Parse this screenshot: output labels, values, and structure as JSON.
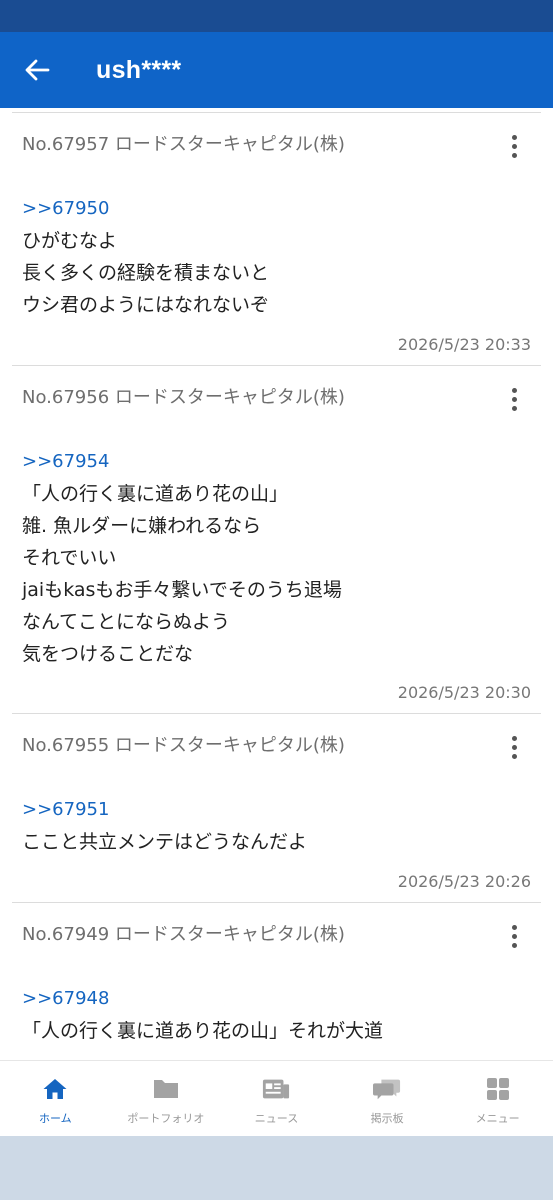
{
  "header": {
    "title": "ush****"
  },
  "posts": [
    {
      "header": "No.67957 ロードスターキャピタル(株)",
      "reply_to": ">>67950",
      "lines": [
        "ひがむなよ",
        "長く多くの経験を積まないと",
        "ウシ君のようにはなれないぞ"
      ],
      "timestamp": "2026/5/23 20:33"
    },
    {
      "header": "No.67956 ロードスターキャピタル(株)",
      "reply_to": ">>67954",
      "lines": [
        "「人の行く裏に道あり花の山」",
        "雑. 魚ルダーに嫌われるなら",
        "それでいい",
        "jaiもkasもお手々繋いでそのうち退場",
        "なんてことにならぬよう",
        "気をつけることだな"
      ],
      "timestamp": "2026/5/23 20:30"
    },
    {
      "header": "No.67955 ロードスターキャピタル(株)",
      "reply_to": ">>67951",
      "lines": [
        "ここと共立メンテはどうなんだよ"
      ],
      "timestamp": "2026/5/23 20:26"
    },
    {
      "header": "No.67949 ロードスターキャピタル(株)",
      "reply_to": ">>67948",
      "lines": [
        "「人の行く裏に道あり花の山」それが大道"
      ],
      "timestamp": ""
    }
  ],
  "nav": [
    {
      "label": "ホーム",
      "icon": "home-icon",
      "active": true
    },
    {
      "label": "ポートフォリオ",
      "icon": "folder-icon",
      "active": false
    },
    {
      "label": "ニュース",
      "icon": "news-icon",
      "active": false
    },
    {
      "label": "掲示板",
      "icon": "chat-icon",
      "active": false
    },
    {
      "label": "メニュー",
      "icon": "grid-icon",
      "active": false
    }
  ],
  "colors": {
    "statusbar": "#1a4c92",
    "appbar": "#0f64c8",
    "link": "#1565c0",
    "nav_inactive": "#999999",
    "bottom_area": "#cdd9e6"
  }
}
